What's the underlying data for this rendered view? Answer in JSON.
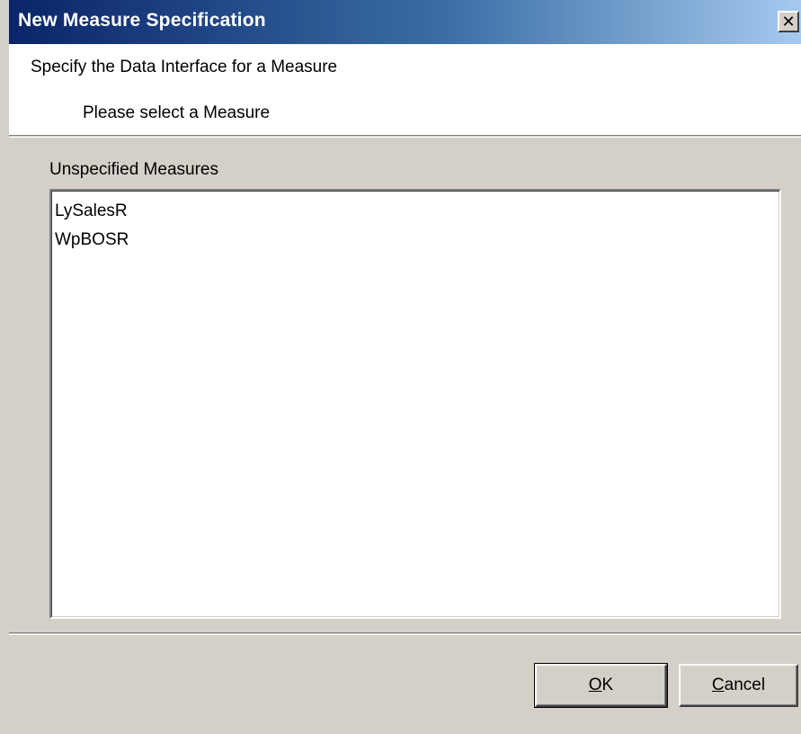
{
  "window": {
    "title": "New Measure Specification",
    "close_glyph": "✕"
  },
  "header": {
    "title": "Specify the Data Interface for a Measure",
    "subtitle": "Please select a Measure"
  },
  "list": {
    "label": "Unspecified Measures",
    "items": [
      "LySalesR",
      "WpBOSR"
    ]
  },
  "buttons": {
    "ok_mnemonic": "O",
    "ok_rest": "K",
    "cancel_mnemonic": "C",
    "cancel_rest": "ancel"
  },
  "colors": {
    "titlebar_start": "#0a246a",
    "titlebar_end": "#a6caf0",
    "dialog_face": "#d4d0c8"
  }
}
